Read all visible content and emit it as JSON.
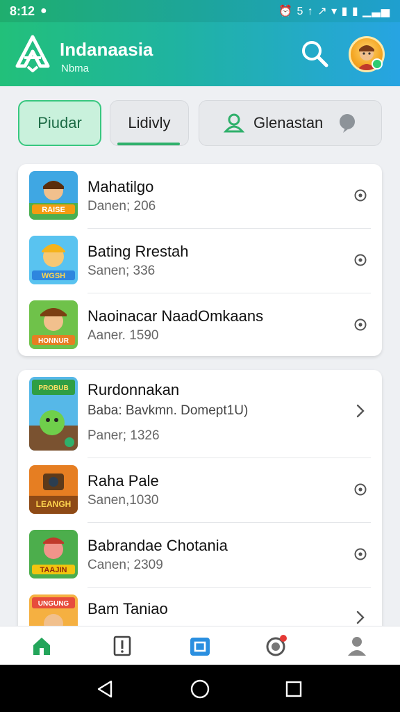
{
  "status_bar": {
    "time": "8:12",
    "icons_text": "⏰ 5 ↑ ↗ ▾ ▮ ▮ ▁▃▅"
  },
  "header": {
    "title": "Indanaasia",
    "subtitle": "Nbma",
    "icons": [
      "logo-icon",
      "search-icon",
      "avatar"
    ]
  },
  "tabs": [
    {
      "label": "Piudar",
      "active": true
    },
    {
      "label": "Lidivly",
      "active": false
    },
    {
      "label": "Glenastan",
      "active": false
    }
  ],
  "list_group_1": [
    {
      "title": "Mahatilgo",
      "subtitle": "Danen; 206",
      "trail": "radio-icon"
    },
    {
      "title": "Bating Rrestah",
      "subtitle": "Sanen; 336",
      "trail": "radio-icon"
    },
    {
      "title": "Naoinacar NaadOmkaans",
      "subtitle": "Aaner. 1590",
      "trail": "radio-icon"
    }
  ],
  "list_group_2": [
    {
      "title": "Rurdonnakan",
      "subtitle": "Baba: Bavkmn. Domept1U)",
      "extra": "Paner; 1326",
      "trail": "chevron-right-icon"
    },
    {
      "title": "Raha Pale",
      "subtitle": "Sanen,1030",
      "trail": "radio-icon"
    },
    {
      "title": "Babrandae Chotania",
      "subtitle": "Canen; 2309",
      "trail": "radio-icon"
    },
    {
      "title": "Bam Taniao",
      "subtitle": "",
      "trail": "chevron-right-icon"
    }
  ],
  "colors": {
    "accent_green": "#2fb06b",
    "header_gradient_start": "#22c07a",
    "header_gradient_end": "#27a4e2",
    "nav_active_blue": "#2a8fe0"
  },
  "bottom_nav": [
    "home-icon",
    "info-icon",
    "store-icon",
    "chat-icon",
    "profile-icon"
  ]
}
